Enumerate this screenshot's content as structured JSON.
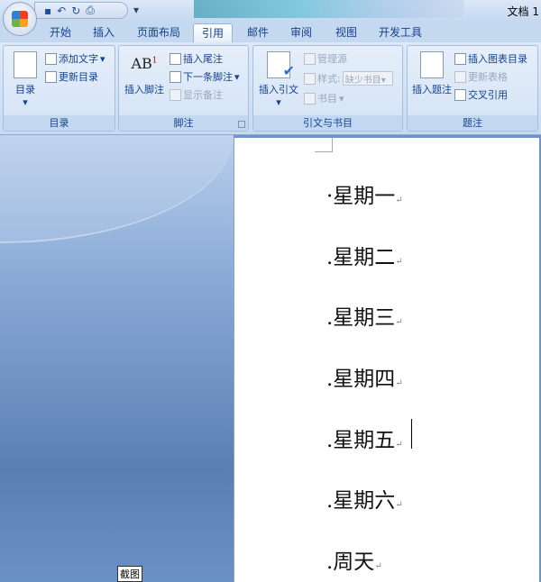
{
  "window": {
    "title": "文档 1"
  },
  "quick_access": {
    "icons": [
      "save-icon",
      "undo-icon",
      "redo-icon",
      "print-preview-icon"
    ]
  },
  "tabs": [
    {
      "label": "开始"
    },
    {
      "label": "插入"
    },
    {
      "label": "页面布局"
    },
    {
      "label": "引用",
      "active": true
    },
    {
      "label": "邮件"
    },
    {
      "label": "审阅"
    },
    {
      "label": "视图"
    },
    {
      "label": "开发工具"
    }
  ],
  "ribbon": {
    "toc": {
      "label": "目录",
      "big": "目录",
      "add_text": "添加文字",
      "update": "更新目录"
    },
    "footnotes": {
      "label": "脚注",
      "big": "插入脚注",
      "endnote": "插入尾注",
      "next": "下一条脚注",
      "show": "显示备注"
    },
    "citations": {
      "label": "引文与书目",
      "big": "插入引文",
      "manage": "管理源",
      "style_label": "样式:",
      "style_value": "缺少书目",
      "bibliography": "书目"
    },
    "captions": {
      "label": "题注",
      "big": "插入题注",
      "table_of_figures": "插入图表目录",
      "update_table": "更新表格",
      "cross_ref": "交叉引用"
    }
  },
  "document": {
    "lines": [
      "·星期一",
      ".星期二",
      ".星期三",
      ".星期四",
      ".星期五",
      ".星期六",
      ".周天"
    ],
    "paragraph_mark": "↵"
  },
  "tooltip": "截图"
}
